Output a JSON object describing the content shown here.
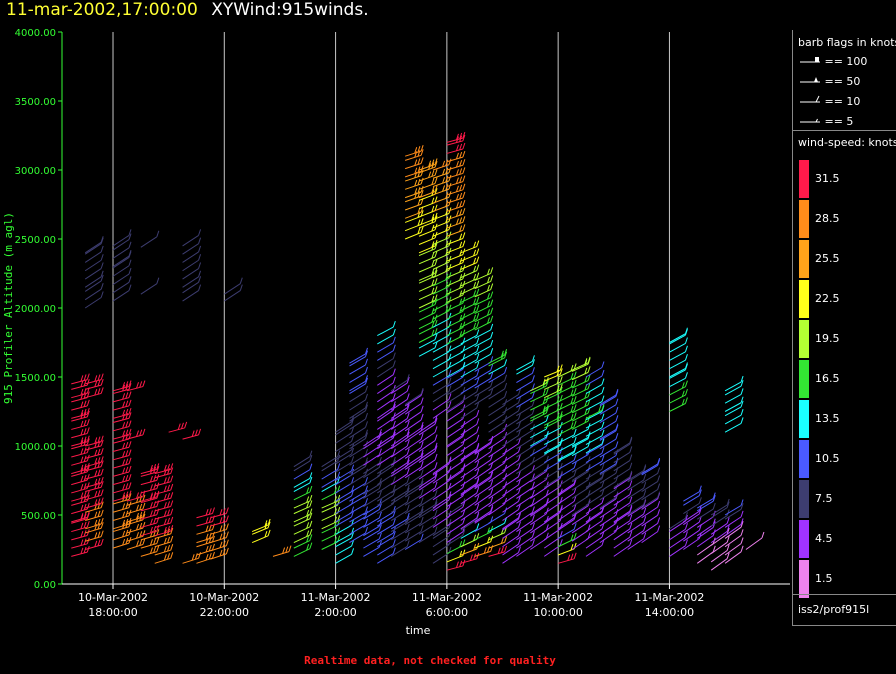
{
  "title": {
    "date": "11-mar-2002,17:00:00",
    "name": "XYWind:915winds."
  },
  "legend_barb": {
    "title": "barb flags in knots",
    "rows": [
      "== 100",
      "== 50",
      "== 10",
      "== 5"
    ]
  },
  "legend_speed": {
    "title": "wind-speed: knots",
    "labels": [
      "31.5",
      "28.5",
      "25.5",
      "22.5",
      "19.5",
      "16.5",
      "13.5",
      "10.5",
      "7.5",
      "4.5",
      "1.5"
    ],
    "colors": [
      "#ff1a4a",
      "#ff8c1a",
      "#ffa31a",
      "#ffff1a",
      "#b3ff33",
      "#33e633",
      "#1affff",
      "#4a5aff",
      "#3d3d70",
      "#a033ff",
      "#ee82ee"
    ]
  },
  "source": "iss2/prof915l",
  "quality_note": "Realtime data, not checked for quality",
  "chart_data": {
    "type": "scatter",
    "xlabel": "time",
    "ylabel": "915 Profiler Altitude (m agl)",
    "ylim": [
      0,
      4000
    ],
    "yticks": [
      "0.00",
      "500.00",
      "1000.00",
      "1500.00",
      "2000.00",
      "2500.00",
      "3000.00",
      "3500.00",
      "4000.00"
    ],
    "xlim": [
      "2002-03-10 16:10",
      "2002-03-11 18:20"
    ],
    "xticks": [
      {
        "t": "2002-03-10 18:00",
        "date": "10-Mar-2002",
        "time": "18:00:00"
      },
      {
        "t": "2002-03-10 22:00",
        "date": "10-Mar-2002",
        "time": "22:00:00"
      },
      {
        "t": "2002-03-11 02:00",
        "date": "11-Mar-2002",
        "time": "2:00:00"
      },
      {
        "t": "2002-03-11 06:00",
        "date": "11-Mar-2002",
        "time": "6:00:00"
      },
      {
        "t": "2002-03-11 10:00",
        "date": "11-Mar-2002",
        "time": "10:00:00"
      },
      {
        "t": "2002-03-11 14:00",
        "date": "11-Mar-2002",
        "time": "14:00:00"
      }
    ],
    "grid": "vertical",
    "profiles": [
      {
        "t": "2002-03-10 16:30",
        "alt": [
          200,
          450,
          600,
          800,
          1000,
          1200,
          1350,
          1450
        ],
        "wspd": [
          31,
          30,
          30,
          30,
          31,
          31,
          31,
          31
        ]
      },
      {
        "t": "2002-03-10 17:00",
        "alt": [
          250,
          400,
          550,
          700,
          850,
          1000,
          1350,
          1450
        ],
        "wspd": [
          30,
          29,
          30,
          31,
          31,
          31,
          31,
          31
        ]
      },
      {
        "t": "2002-03-10 18:00",
        "alt": [
          260,
          400,
          600,
          900,
          1050,
          1200,
          1400
        ],
        "wspd": [
          28,
          29,
          30,
          31,
          31,
          31,
          31
        ]
      },
      {
        "t": "2002-03-10 18:30",
        "alt": [
          250,
          450,
          600,
          1050,
          1400
        ],
        "wspd": [
          28,
          29,
          30,
          31,
          31
        ]
      },
      {
        "t": "2002-03-10 19:00",
        "alt": [
          200,
          350,
          600,
          800
        ],
        "wspd": [
          29,
          30,
          31,
          31
        ]
      },
      {
        "t": "2002-03-10 19:30",
        "alt": [
          150,
          350,
          650,
          800
        ],
        "wspd": [
          28,
          30,
          31,
          31
        ]
      },
      {
        "t": "2002-03-10 20:00",
        "alt": [
          1100
        ],
        "wspd": [
          31
        ]
      },
      {
        "t": "2002-03-10 20:30",
        "alt": [
          150,
          1050
        ],
        "wspd": [
          28,
          31
        ]
      },
      {
        "t": "2002-03-10 21:00",
        "alt": [
          150,
          300,
          480
        ],
        "wspd": [
          27,
          29,
          31
        ]
      },
      {
        "t": "2002-03-10 21:30",
        "alt": [
          180,
          300,
          480
        ],
        "wspd": [
          27,
          28,
          31
        ]
      },
      {
        "t": "2002-03-10 17:00",
        "alt": [
          2000,
          2150,
          2400
        ],
        "wspd": [
          6,
          6,
          6
        ]
      },
      {
        "t": "2002-03-10 18:00",
        "alt": [
          2050,
          2300,
          2450
        ],
        "wspd": [
          6,
          6,
          6
        ]
      },
      {
        "t": "2002-03-10 19:00",
        "alt": [
          2100,
          2440
        ],
        "wspd": [
          6,
          6
        ]
      },
      {
        "t": "2002-03-10 20:30",
        "alt": [
          2050,
          2150,
          2450
        ],
        "wspd": [
          6,
          6,
          6
        ]
      },
      {
        "t": "2002-03-10 22:00",
        "alt": [
          2050,
          2100
        ],
        "wspd": [
          6,
          6
        ]
      },
      {
        "t": "2002-03-10 23:00",
        "alt": [
          300,
          380
        ],
        "wspd": [
          21,
          22
        ]
      },
      {
        "t": "2002-03-10 23:45",
        "alt": [
          200
        ],
        "wspd": [
          29
        ]
      },
      {
        "t": "2002-03-11 00:30",
        "alt": [
          200,
          300,
          450,
          550,
          700,
          850
        ],
        "wspd": [
          17,
          18,
          19,
          20,
          12,
          8
        ]
      },
      {
        "t": "2002-03-11 01:30",
        "alt": [
          250,
          400,
          550,
          700,
          850
        ],
        "wspd": [
          17,
          18,
          20,
          10,
          8
        ]
      },
      {
        "t": "2002-03-11 02:00",
        "alt": [
          150,
          300,
          450,
          600,
          750,
          900,
          1100
        ],
        "wspd": [
          12,
          13,
          11,
          10,
          9,
          8,
          6
        ]
      },
      {
        "t": "2002-03-11 02:30",
        "alt": [
          300,
          450,
          600,
          800,
          1000,
          1200,
          1400,
          1600
        ],
        "wspd": [
          10,
          11,
          10,
          8,
          7,
          6,
          10,
          11
        ]
      },
      {
        "t": "2002-03-11 03:00",
        "alt": [
          200,
          350,
          500,
          650,
          800,
          1000
        ],
        "wspd": [
          11,
          10,
          9,
          8,
          6,
          5
        ]
      },
      {
        "t": "2002-03-11 03:30",
        "alt": [
          150,
          300,
          450,
          600,
          800,
          1000,
          1200,
          1500,
          1800
        ],
        "wspd": [
          9,
          10,
          9,
          7,
          6,
          5,
          4,
          6,
          14
        ]
      },
      {
        "t": "2002-03-11 04:00",
        "alt": [
          200,
          400,
          600,
          800,
          1000,
          1200,
          1400
        ],
        "wspd": [
          8,
          9,
          7,
          5,
          4,
          5,
          6
        ]
      },
      {
        "t": "2002-03-11 04:30",
        "alt": [
          2500,
          2650,
          2800,
          2950,
          3100
        ],
        "wspd": [
          22,
          24,
          26,
          27,
          28
        ]
      },
      {
        "t": "2002-03-11 04:30",
        "alt": [
          250,
          450,
          650,
          850,
          1050,
          1300
        ],
        "wspd": [
          9,
          8,
          7,
          5,
          4,
          6
        ]
      },
      {
        "t": "2002-03-11 05:00",
        "alt": [
          1650,
          1750,
          1850,
          2000,
          2200,
          2400,
          2600,
          2800,
          3000
        ],
        "wspd": [
          14,
          15,
          16,
          18,
          20,
          21,
          23,
          24,
          26
        ]
      },
      {
        "t": "2002-03-11 05:00",
        "alt": [
          300,
          500,
          700,
          900,
          1100
        ],
        "wspd": [
          8,
          7,
          5,
          4,
          5
        ]
      },
      {
        "t": "2002-03-11 05:30",
        "alt": [
          150,
          350,
          550,
          800,
          1200,
          1500,
          1800,
          2100,
          2400,
          2700,
          3000
        ],
        "wspd": [
          7,
          6,
          5,
          4,
          4,
          12,
          14,
          17,
          20,
          24,
          27
        ]
      },
      {
        "t": "2002-03-11 06:00",
        "alt": [
          100,
          300,
          500,
          750,
          1000,
          1250,
          1500,
          1800,
          2100,
          2400,
          2700,
          3000,
          3200
        ],
        "wspd": [
          31,
          5,
          6,
          4,
          5,
          6,
          12,
          16,
          19,
          23,
          27,
          29,
          31
        ]
      },
      {
        "t": "2002-03-11 06:30",
        "alt": [
          150,
          400,
          650,
          900,
          1200,
          1500,
          1800,
          2100,
          2400
        ],
        "wspd": [
          30,
          5,
          4,
          5,
          6,
          12,
          15,
          18,
          23
        ]
      },
      {
        "t": "2002-03-11 07:00",
        "alt": [
          200,
          450,
          700,
          950,
          1300,
          1600,
          1900,
          2200
        ],
        "wspd": [
          28,
          5,
          4,
          5,
          8,
          12,
          16,
          20
        ]
      },
      {
        "t": "2002-03-11 07:30",
        "alt": [
          200,
          500,
          800,
          1100,
          1400,
          1600
        ],
        "wspd": [
          30,
          4,
          5,
          6,
          8,
          16
        ]
      },
      {
        "t": "2002-03-11 08:00",
        "alt": [
          150,
          400,
          700,
          1000,
          1300
        ],
        "wspd": [
          5,
          4,
          5,
          6,
          8
        ]
      },
      {
        "t": "2002-03-11 08:30",
        "alt": [
          200,
          500,
          800,
          1100,
          1400,
          1550
        ],
        "wspd": [
          4,
          5,
          6,
          8,
          10,
          13
        ]
      },
      {
        "t": "2002-03-11 09:00",
        "alt": [
          250,
          500,
          750,
          1000,
          1200,
          1400
        ],
        "wspd": [
          5,
          4,
          6,
          12,
          16,
          18
        ]
      },
      {
        "t": "2002-03-11 09:30",
        "alt": [
          200,
          450,
          700,
          950,
          1150,
          1350,
          1500
        ],
        "wspd": [
          4,
          5,
          6,
          13,
          16,
          18,
          22
        ]
      },
      {
        "t": "2002-03-11 10:00",
        "alt": [
          150,
          400,
          650,
          900,
          1200,
          1500
        ],
        "wspd": [
          30,
          4,
          5,
          14,
          16,
          18
        ]
      },
      {
        "t": "2002-03-11 10:30",
        "alt": [
          250,
          500,
          750,
          1000,
          1300,
          1550
        ],
        "wspd": [
          5,
          6,
          7,
          14,
          17,
          19
        ]
      },
      {
        "t": "2002-03-11 11:00",
        "alt": [
          200,
          450,
          700,
          950,
          1200,
          1500
        ],
        "wspd": [
          4,
          5,
          8,
          12,
          15,
          10
        ]
      },
      {
        "t": "2002-03-11 11:30",
        "alt": [
          300,
          550,
          800,
          1050,
          1300
        ],
        "wspd": [
          4,
          6,
          9,
          10,
          10
        ]
      },
      {
        "t": "2002-03-11 12:00",
        "alt": [
          200,
          450,
          700,
          950
        ],
        "wspd": [
          4,
          5,
          6,
          8
        ]
      },
      {
        "t": "2002-03-11 12:30",
        "alt": [
          250,
          500,
          750
        ],
        "wspd": [
          5,
          6,
          8
        ]
      },
      {
        "t": "2002-03-11 13:00",
        "alt": [
          300,
          550,
          800
        ],
        "wspd": [
          4,
          6,
          10
        ]
      },
      {
        "t": "2002-03-11 14:00",
        "alt": [
          200,
          400,
          1250,
          1500,
          1750
        ],
        "wspd": [
          5,
          6,
          16,
          14,
          13
        ]
      },
      {
        "t": "2002-03-11 14:30",
        "alt": [
          250,
          450,
          600
        ],
        "wspd": [
          4,
          5,
          10
        ]
      },
      {
        "t": "2002-03-11 15:00",
        "alt": [
          150,
          350,
          550
        ],
        "wspd": [
          2,
          4,
          10
        ]
      },
      {
        "t": "2002-03-11 15:30",
        "alt": [
          100,
          300,
          500
        ],
        "wspd": [
          2,
          3,
          8
        ]
      },
      {
        "t": "2002-03-11 16:00",
        "alt": [
          1100,
          1250,
          1400
        ],
        "wspd": [
          13,
          13,
          13
        ]
      },
      {
        "t": "2002-03-11 16:00",
        "alt": [
          150,
          350,
          500
        ],
        "wspd": [
          2,
          3,
          10
        ]
      },
      {
        "t": "2002-03-11 16:45",
        "alt": [
          250
        ],
        "wspd": [
          2
        ]
      }
    ]
  }
}
